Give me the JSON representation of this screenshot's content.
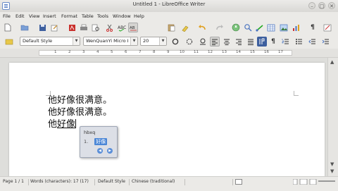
{
  "window": {
    "title": "Untitled 1 - LibreOffice Writer",
    "controls": [
      "–",
      "□",
      "✕"
    ]
  },
  "menu": [
    "File",
    "Edit",
    "View",
    "Insert",
    "Format",
    "Table",
    "Tools",
    "Window",
    "Help"
  ],
  "formatting": {
    "paragraph_style": "Default Style",
    "font_name": "WenQuanYi Micro I",
    "font_size": "20"
  },
  "ruler": {
    "ticks": [
      "1",
      "2",
      "3",
      "4",
      "5",
      "6",
      "7",
      "8",
      "9",
      "10",
      "11",
      "12",
      "13",
      "14",
      "15",
      "16",
      "17"
    ]
  },
  "document": {
    "lines": [
      "他好像很满意。",
      "他好像很满意。"
    ],
    "current_committed": "他",
    "current_preedit": "好像"
  },
  "ime": {
    "input": "hbxq",
    "candidate_index": "1.",
    "candidate": "好像"
  },
  "status": {
    "page": "Page 1 / 1",
    "words": "Words (characters): 17 (17)",
    "style": "Default Style",
    "language": "Chinese (traditional)"
  },
  "colors": {
    "accent": "#4a86d6",
    "page": "#ffffff",
    "chrome": "#ebeae7"
  }
}
